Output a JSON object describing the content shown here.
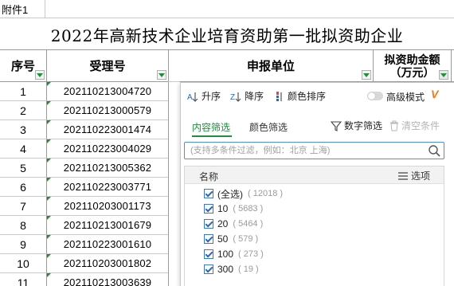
{
  "attachment_label": "附件1",
  "sheet_title": "2022年高新技术企业培育资助第一批拟资助企业",
  "columns": {
    "seq": "序号",
    "accept_no": "受理号",
    "applicant": "申报单位",
    "amount_line1": "拟资助金额",
    "amount_line2": "（万元）"
  },
  "rows": [
    {
      "seq": "1",
      "code": "202110213004720"
    },
    {
      "seq": "2",
      "code": "202110213000579"
    },
    {
      "seq": "3",
      "code": "202110223001474"
    },
    {
      "seq": "4",
      "code": "202110223004029"
    },
    {
      "seq": "5",
      "code": "202110213005362"
    },
    {
      "seq": "6",
      "code": "202110223003771"
    },
    {
      "seq": "7",
      "code": "202110203001173"
    },
    {
      "seq": "8",
      "code": "202110213001679"
    },
    {
      "seq": "9",
      "code": "202110223001610"
    },
    {
      "seq": "10",
      "code": "202110203001802"
    },
    {
      "seq": "11",
      "code": "202110213003639"
    }
  ],
  "filter_panel": {
    "sort_asc": "升序",
    "sort_desc": "降序",
    "sort_color": "颜色排序",
    "advanced_mode": "高级模式",
    "vip_badge": "V",
    "tab_content": "内容筛选",
    "tab_color": "颜色筛选",
    "number_filter": "数字筛选",
    "clear_condition": "清空条件",
    "search_placeholder": "(支持多条件过滤，例如：北京 上海)",
    "list_header_name": "名称",
    "list_header_options": "选项",
    "items": [
      {
        "label": "(全选)",
        "count": "( 12018 )",
        "checked": true
      },
      {
        "label": "10",
        "count": "( 5683 )",
        "checked": true
      },
      {
        "label": "20",
        "count": "( 5464 )",
        "checked": true
      },
      {
        "label": "50",
        "count": "( 579 )",
        "checked": true
      },
      {
        "label": "100",
        "count": "( 273 )",
        "checked": true
      },
      {
        "label": "300",
        "count": "( 19 )",
        "checked": true
      }
    ]
  },
  "colors": {
    "accent_green": "#1e8f3b",
    "vip_orange": "#f07a1a",
    "checkbox_blue": "#3b78c8"
  }
}
